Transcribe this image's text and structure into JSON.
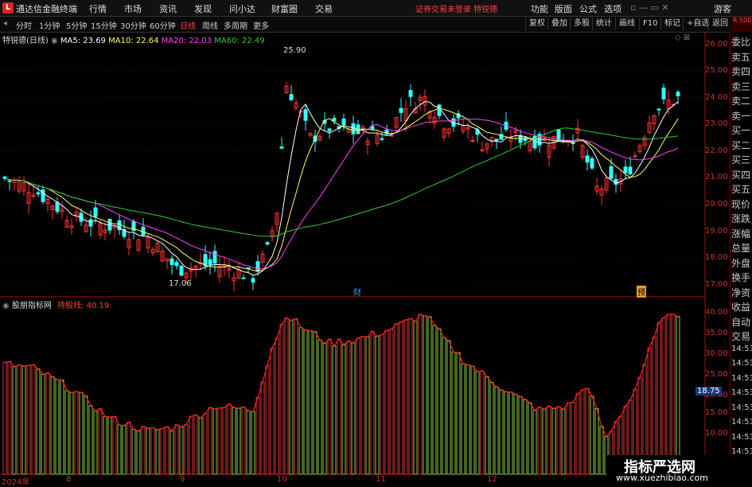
{
  "app": {
    "title": "通达信金融终端",
    "menu": [
      "行情",
      "市场",
      "资讯",
      "发现",
      "问小达",
      "财富圈",
      "交易"
    ],
    "notice": "证券交易未登录  特锐德",
    "right_menu": [
      "功能",
      "版面",
      "公式",
      "选项"
    ],
    "guest": "游客"
  },
  "toolbar": {
    "periods": [
      "分时",
      "1分钟",
      "5分钟",
      "15分钟",
      "30分钟",
      "60分钟",
      "日线",
      "周线",
      "多周期",
      "更多"
    ],
    "active": "日线",
    "right_buttons": [
      "复权",
      "叠加",
      "多股",
      "统计",
      "画线",
      "F10",
      "标记",
      "+自选",
      "返回"
    ]
  },
  "main_chart": {
    "legend_title": "特锐德(日线)",
    "ma": [
      {
        "label": "MA5: 23.69",
        "color": "#ffffff"
      },
      {
        "label": "MA10: 22.64",
        "color": "#ffff66"
      },
      {
        "label": "MA20: 22.03",
        "color": "#ff44ff"
      },
      {
        "label": "MA60: 22.49",
        "color": "#33cc33"
      }
    ],
    "high_label": "25.90",
    "low_label": "17.06",
    "marker_cai": "财",
    "marker_yu": "预",
    "y_ticks": [
      "26.00",
      "25.00",
      "24.00",
      "23.00",
      "22.00",
      "21.00",
      "20.00",
      "19.00",
      "18.00",
      "17.00"
    ]
  },
  "indicator": {
    "name": "股朋指标网",
    "line_label": "持股线: 40.19",
    "y_ticks": [
      "40.00",
      "35.00",
      "30.00",
      "25.00",
      "20.00",
      "15.00",
      "10.00"
    ],
    "current": "18.75"
  },
  "x_axis": {
    "labels": [
      "2024年",
      "8",
      "9",
      "10",
      "11",
      "12"
    ]
  },
  "side_panel": {
    "top_label": "R 500",
    "items": [
      "委比",
      "卖五",
      "卖四",
      "卖三",
      "卖二",
      "卖一",
      "买一",
      "买二",
      "买三",
      "买四",
      "买五",
      "现价",
      "涨跌",
      "涨幅",
      "总量",
      "外盘",
      "换手",
      "净资",
      "收益",
      "自动",
      "交易",
      "14:53",
      "14:53",
      "14:53",
      "14:53",
      "14:53",
      "14:53",
      "14:53",
      "14:53",
      "14:53"
    ]
  },
  "watermark": {
    "line1": "指标严选网",
    "line2": "www.xuezhibiao.com"
  }
}
